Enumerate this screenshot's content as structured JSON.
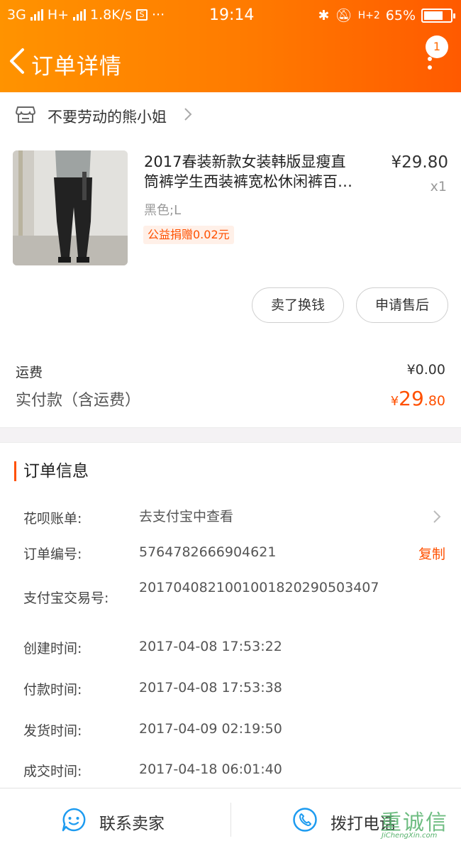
{
  "status_bar": {
    "network1": "3G",
    "network2": "H+",
    "speed": "1.8K/s",
    "time": "19:14",
    "network3": "H+2",
    "battery": "65%"
  },
  "header": {
    "title": "订单详情",
    "badge": "1"
  },
  "shop": {
    "name": "不要劳动的熊小姐"
  },
  "product": {
    "name_line1": "2017春装新款女装韩版显瘦直",
    "name_line2": "筒裤学生西装裤宽松休闲裤百…",
    "price": "¥29.80",
    "quantity": "x1",
    "spec": "黑色;L",
    "charity": "公益捐赠0.02元"
  },
  "actions": {
    "sell_label": "卖了换钱",
    "after_sale_label": "申请售后"
  },
  "summary": {
    "shipping_label": "运费",
    "shipping_value": "¥0.00",
    "paid_label": "实付款（含运费）",
    "paid_currency": "¥",
    "paid_int": "29",
    "paid_dec": ".80"
  },
  "order_info": {
    "title": "订单信息",
    "rows": [
      {
        "key": "花呗账单:",
        "value": "去支付宝中查看"
      },
      {
        "key": "订单编号:",
        "value": "5764782666904621",
        "action": "复制"
      },
      {
        "key": "支付宝交易号:",
        "value": "2017040821001001820290503407"
      },
      {
        "key": "创建时间:",
        "value": "2017-04-08 17:53:22"
      },
      {
        "key": "付款时间:",
        "value": "2017-04-08 17:53:38"
      },
      {
        "key": "发货时间:",
        "value": "2017-04-09 02:19:50"
      },
      {
        "key": "成交时间:",
        "value": "2017-04-18 06:01:40"
      }
    ]
  },
  "bottom_bar": {
    "contact_label": "联系卖家",
    "call_label": "拨打电话"
  },
  "watermark": {
    "main": "重诚信",
    "sub": "JiChengXin.com"
  },
  "colors": {
    "header_start": "#ff9300",
    "header_end": "#ff5a00",
    "accent": "#ff5000"
  }
}
